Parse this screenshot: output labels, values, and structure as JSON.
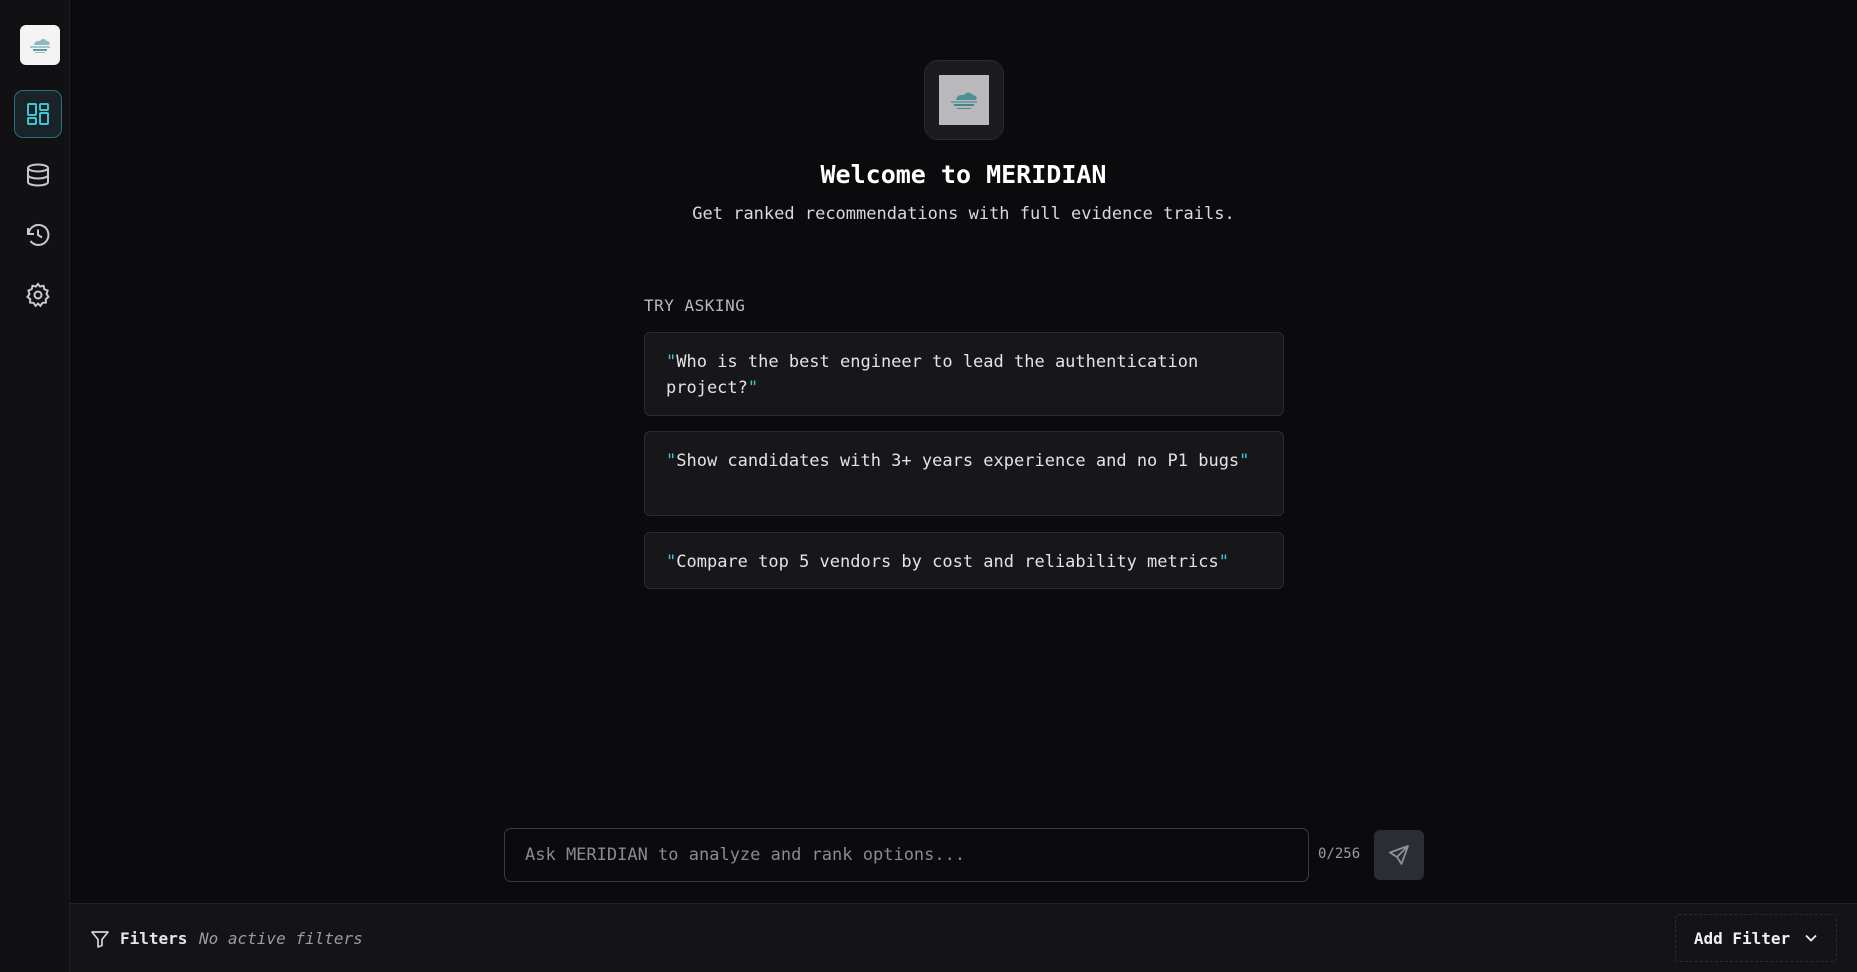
{
  "sidebar": {
    "items": [
      {
        "name": "dashboard",
        "icon": "dashboard-icon",
        "active": true
      },
      {
        "name": "database",
        "icon": "database-icon",
        "active": false
      },
      {
        "name": "history",
        "icon": "history-icon",
        "active": false
      },
      {
        "name": "settings",
        "icon": "gear-icon",
        "active": false
      }
    ]
  },
  "welcome": {
    "title": "Welcome to MERIDIAN",
    "subtitle": "Get ranked recommendations with full evidence trails."
  },
  "suggestions": {
    "label": "TRY ASKING",
    "items": [
      "Who is the best engineer to lead the authentication project?",
      "Show candidates with 3+ years experience and no P1 bugs",
      "Compare top 5 vendors by cost and reliability metrics"
    ]
  },
  "input": {
    "placeholder": "Ask MERIDIAN to analyze and rank options...",
    "value": "",
    "char_count": "0/256"
  },
  "filters": {
    "label": "Filters",
    "status": "No active filters",
    "add_label": "Add Filter"
  },
  "colors": {
    "accent": "#3fc3d6",
    "background": "#0b0b0d",
    "sidebar": "#111114"
  }
}
